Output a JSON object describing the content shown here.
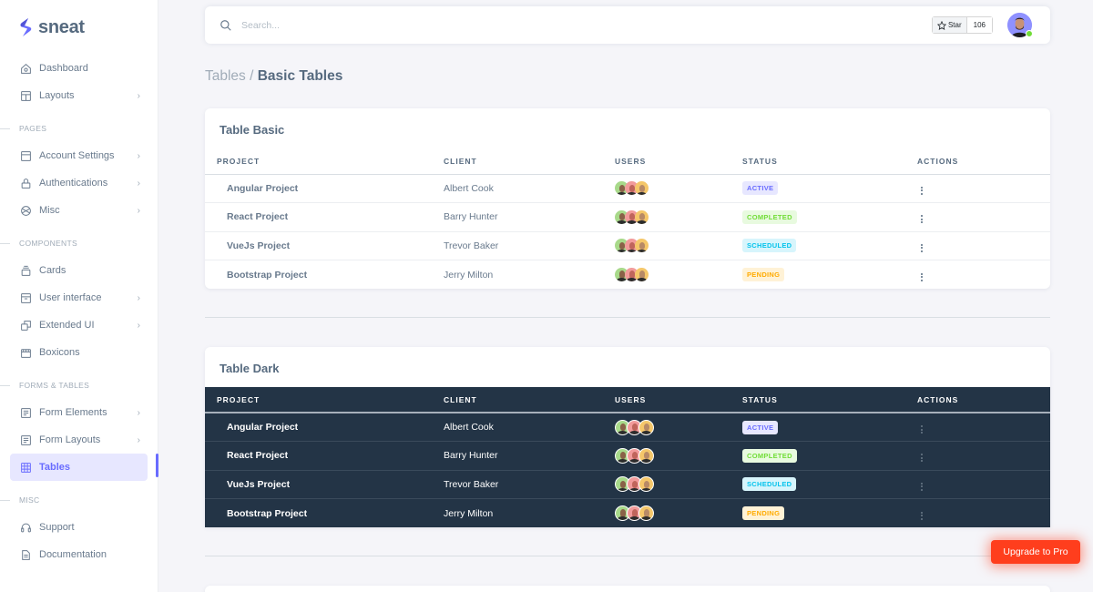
{
  "brand": {
    "name": "sneat",
    "accent": "#696cff"
  },
  "sidebar": {
    "items": [
      {
        "type": "item",
        "label": "Dashboard",
        "icon": "home-icon",
        "chevron": false
      },
      {
        "type": "item",
        "label": "Layouts",
        "icon": "layout-icon",
        "chevron": true
      },
      {
        "type": "header",
        "label": "Pages"
      },
      {
        "type": "item",
        "label": "Account Settings",
        "icon": "dock-top-icon",
        "chevron": true
      },
      {
        "type": "item",
        "label": "Authentications",
        "icon": "lock-icon",
        "chevron": true
      },
      {
        "type": "item",
        "label": "Misc",
        "icon": "cube-icon",
        "chevron": true
      },
      {
        "type": "header",
        "label": "Components"
      },
      {
        "type": "item",
        "label": "Cards",
        "icon": "collection-icon",
        "chevron": false
      },
      {
        "type": "item",
        "label": "User interface",
        "icon": "box-icon",
        "chevron": true
      },
      {
        "type": "item",
        "label": "Extended UI",
        "icon": "copy-icon",
        "chevron": true
      },
      {
        "type": "item",
        "label": "Boxicons",
        "icon": "crown-icon",
        "chevron": false
      },
      {
        "type": "header",
        "label": "Forms & Tables"
      },
      {
        "type": "item",
        "label": "Form Elements",
        "icon": "detail-icon",
        "chevron": true
      },
      {
        "type": "item",
        "label": "Form Layouts",
        "icon": "detail-icon",
        "chevron": true
      },
      {
        "type": "item",
        "label": "Tables",
        "icon": "table-icon",
        "chevron": false,
        "active": true
      },
      {
        "type": "header",
        "label": "Misc"
      },
      {
        "type": "item",
        "label": "Support",
        "icon": "support-icon",
        "chevron": false
      },
      {
        "type": "item",
        "label": "Documentation",
        "icon": "file-icon",
        "chevron": false
      }
    ]
  },
  "navbar": {
    "search_placeholder": "Search...",
    "star_label": "Star",
    "star_count": "106",
    "avatar_status": "online"
  },
  "breadcrumb": {
    "parent": "Tables /",
    "current": "Basic Tables"
  },
  "status_styles": {
    "Active": {
      "bg": "#e7e7ff",
      "fg": "#696cff"
    },
    "Completed": {
      "bg": "#e8fadf",
      "fg": "#71dd37"
    },
    "Scheduled": {
      "bg": "#d7f5fc",
      "fg": "#03c3ec"
    },
    "Pending": {
      "bg": "#fff2d6",
      "fg": "#ffab00"
    }
  },
  "tables": [
    {
      "title": "Table Basic",
      "variant": "light",
      "columns": [
        "Project",
        "Client",
        "Users",
        "Status",
        "Actions"
      ],
      "rows": [
        {
          "project": "Angular Project",
          "client": "Albert Cook",
          "status": "Active"
        },
        {
          "project": "React Project",
          "client": "Barry Hunter",
          "status": "Completed"
        },
        {
          "project": "VueJs Project",
          "client": "Trevor Baker",
          "status": "Scheduled"
        },
        {
          "project": "Bootstrap Project",
          "client": "Jerry Milton",
          "status": "Pending"
        }
      ]
    },
    {
      "title": "Table Dark",
      "variant": "dark",
      "columns": [
        "Project",
        "Client",
        "Users",
        "Status",
        "Actions"
      ],
      "rows": [
        {
          "project": "Angular Project",
          "client": "Albert Cook",
          "status": "Active"
        },
        {
          "project": "React Project",
          "client": "Barry Hunter",
          "status": "Completed"
        },
        {
          "project": "VueJs Project",
          "client": "Trevor Baker",
          "status": "Scheduled"
        },
        {
          "project": "Bootstrap Project",
          "client": "Jerry Milton",
          "status": "Pending"
        }
      ]
    }
  ],
  "user_avatars": [
    {
      "bg": "#a8d98a",
      "skin": "#8a6248"
    },
    {
      "bg": "#f29b9b",
      "skin": "#c0655c"
    },
    {
      "bg": "#f5c76a",
      "skin": "#b88a66"
    }
  ],
  "upgrade_button": {
    "label": "Upgrade to Pro",
    "color": "#ff3e1d"
  }
}
